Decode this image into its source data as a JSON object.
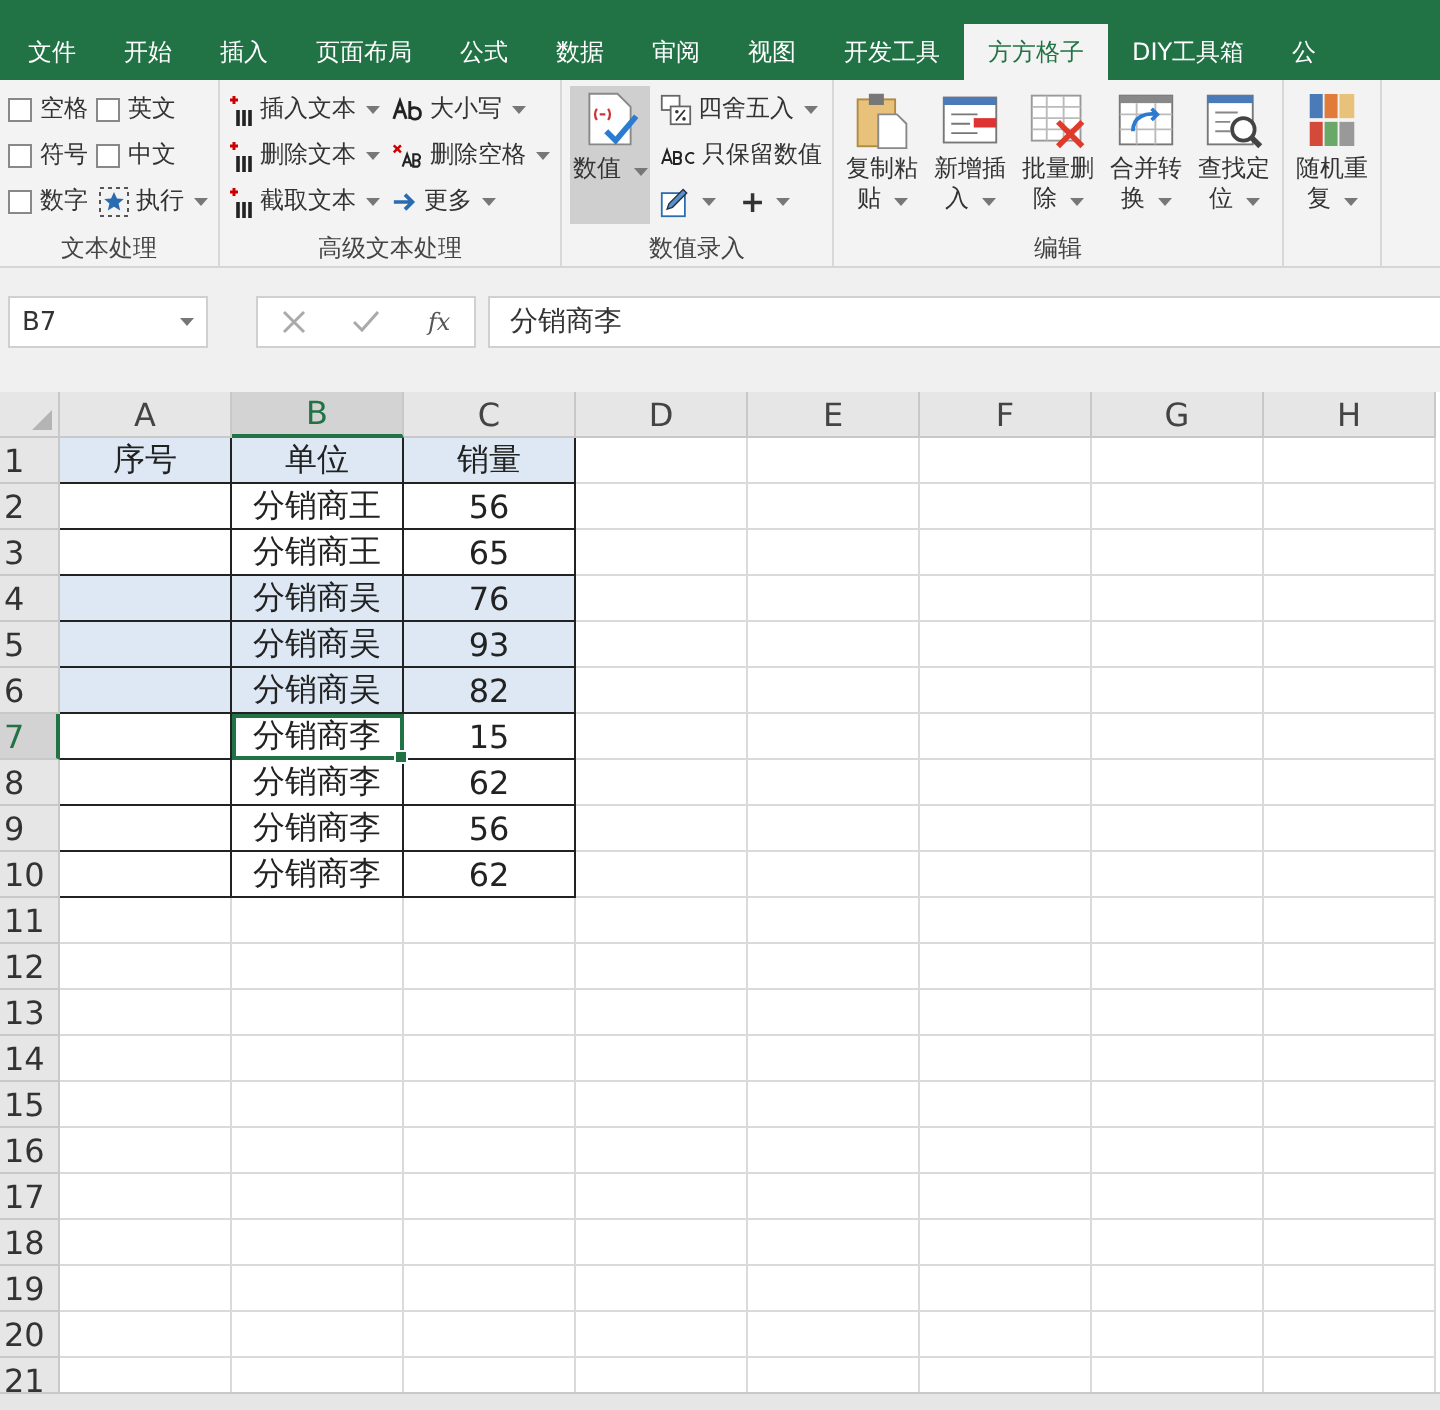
{
  "tabs": [
    {
      "label": "文件",
      "selected": false
    },
    {
      "label": "开始",
      "selected": false
    },
    {
      "label": "插入",
      "selected": false
    },
    {
      "label": "页面布局",
      "selected": false
    },
    {
      "label": "公式",
      "selected": false
    },
    {
      "label": "数据",
      "selected": false
    },
    {
      "label": "审阅",
      "selected": false
    },
    {
      "label": "视图",
      "selected": false
    },
    {
      "label": "开发工具",
      "selected": false
    },
    {
      "label": "方方格子",
      "selected": true
    },
    {
      "label": "DIY工具箱",
      "selected": false
    },
    {
      "label": "公",
      "selected": false
    }
  ],
  "ribbon": {
    "groups": [
      {
        "label": "文本处理",
        "items": [
          {
            "kind": "checkbox",
            "label": "空格",
            "checked": false
          },
          {
            "kind": "checkbox",
            "label": "英文",
            "checked": false
          },
          {
            "kind": "checkbox",
            "label": "符号",
            "checked": false
          },
          {
            "kind": "checkbox",
            "label": "中文",
            "checked": false
          },
          {
            "kind": "checkbox",
            "label": "数字",
            "checked": false
          },
          {
            "kind": "small",
            "label": "执行",
            "dropdown": true
          }
        ]
      },
      {
        "label": "高级文本处理",
        "items": [
          {
            "kind": "small",
            "label": "插入文本",
            "dropdown": true
          },
          {
            "kind": "small",
            "label": "删除文本",
            "dropdown": true
          },
          {
            "kind": "small",
            "label": "截取文本",
            "dropdown": true
          },
          {
            "kind": "small",
            "label": "大小写",
            "dropdown": true
          },
          {
            "kind": "small",
            "label": "删除空格",
            "dropdown": true
          },
          {
            "kind": "small",
            "label": "更多",
            "dropdown": true
          }
        ]
      },
      {
        "label": "数值录入",
        "items": [
          {
            "kind": "large",
            "label": "数值",
            "dropdown": true,
            "pressed": true
          },
          {
            "kind": "small",
            "label": "四舍五入",
            "dropdown": true
          },
          {
            "kind": "small",
            "label": "只保留数值",
            "dropdown": false
          },
          {
            "kind": "small",
            "dropdown": true
          },
          {
            "kind": "small",
            "label": "+",
            "dropdown": true
          }
        ]
      },
      {
        "label": "编辑",
        "items": [
          {
            "kind": "large",
            "label": "复制粘贴",
            "dropdown": true,
            "pressed": false
          },
          {
            "kind": "large",
            "label": "新增插入",
            "dropdown": true,
            "pressed": false
          },
          {
            "kind": "large",
            "label": "批量删除",
            "dropdown": true,
            "pressed": false
          },
          {
            "kind": "large",
            "label": "合并转换",
            "dropdown": true,
            "pressed": false
          },
          {
            "kind": "large",
            "label": "查找定位",
            "dropdown": true,
            "pressed": false
          }
        ]
      },
      {
        "items": [
          {
            "kind": "large",
            "label": "随机重复",
            "dropdown": true,
            "pressed": false
          }
        ]
      }
    ]
  },
  "formula_bar": {
    "name_box": "B7",
    "fx": "fx",
    "content": "分销商李"
  },
  "columns": [
    {
      "label": "A",
      "selected": false
    },
    {
      "label": "B",
      "selected": true
    },
    {
      "label": "C",
      "selected": false
    },
    {
      "label": "D",
      "selected": false
    },
    {
      "label": "E",
      "selected": false
    },
    {
      "label": "F",
      "selected": false
    },
    {
      "label": "G",
      "selected": false
    },
    {
      "label": "H",
      "selected": false
    }
  ],
  "rows": [
    {
      "number": "1",
      "selected": false,
      "highlighted": true,
      "cells": [
        {
          "text": "序号",
          "selected": false
        },
        {
          "text": "单位",
          "selected": false
        },
        {
          "text": "销量",
          "selected": false
        }
      ]
    },
    {
      "number": "2",
      "selected": false,
      "highlighted": false,
      "cells": [
        {
          "selected": false
        },
        {
          "text": "分销商王",
          "selected": false
        },
        {
          "text": "56",
          "selected": false
        }
      ]
    },
    {
      "number": "3",
      "selected": false,
      "highlighted": false,
      "cells": [
        {
          "selected": false
        },
        {
          "text": "分销商王",
          "selected": false
        },
        {
          "text": "65",
          "selected": false
        }
      ]
    },
    {
      "number": "4",
      "selected": false,
      "highlighted": true,
      "cells": [
        {
          "selected": false
        },
        {
          "text": "分销商吴",
          "selected": false
        },
        {
          "text": "76",
          "selected": false
        }
      ]
    },
    {
      "number": "5",
      "selected": false,
      "highlighted": true,
      "cells": [
        {
          "selected": false
        },
        {
          "text": "分销商吴",
          "selected": false
        },
        {
          "text": "93",
          "selected": false
        }
      ]
    },
    {
      "number": "6",
      "selected": false,
      "highlighted": true,
      "cells": [
        {
          "selected": false
        },
        {
          "text": "分销商吴",
          "selected": false
        },
        {
          "text": "82",
          "selected": false
        }
      ]
    },
    {
      "number": "7",
      "selected": true,
      "highlighted": false,
      "cells": [
        {
          "selected": false
        },
        {
          "text": "分销商李",
          "selected": true
        },
        {
          "text": "15",
          "selected": false
        }
      ]
    },
    {
      "number": "8",
      "selected": false,
      "highlighted": false,
      "cells": [
        {
          "selected": false
        },
        {
          "text": "分销商李",
          "selected": false
        },
        {
          "text": "62",
          "selected": false
        }
      ]
    },
    {
      "number": "9",
      "selected": false,
      "highlighted": false,
      "cells": [
        {
          "selected": false
        },
        {
          "text": "分销商李",
          "selected": false
        },
        {
          "text": "56",
          "selected": false
        }
      ]
    },
    {
      "number": "10",
      "selected": false,
      "highlighted": false,
      "cells": [
        {
          "selected": false
        },
        {
          "text": "分销商李",
          "selected": false
        },
        {
          "text": "62",
          "selected": false
        }
      ]
    },
    {
      "number": "11",
      "selected": false
    },
    {
      "number": "12",
      "selected": false
    },
    {
      "number": "13",
      "selected": false
    },
    {
      "number": "14",
      "selected": false
    },
    {
      "number": "15",
      "selected": false
    },
    {
      "number": "16",
      "selected": false
    },
    {
      "number": "17",
      "selected": false
    },
    {
      "number": "18",
      "selected": false
    },
    {
      "number": "19",
      "selected": false
    },
    {
      "number": "20",
      "selected": false
    },
    {
      "number": "21",
      "selected": false
    }
  ]
}
